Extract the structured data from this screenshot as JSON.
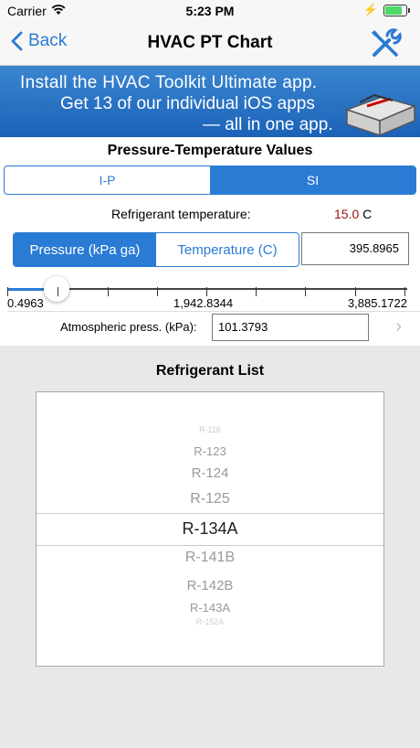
{
  "status_bar": {
    "carrier": "Carrier",
    "time": "5:23 PM"
  },
  "nav": {
    "back_label": "Back",
    "title": "HVAC PT Chart"
  },
  "banner": {
    "line1": "Install the HVAC Toolkit Ultimate app.",
    "line2": "Get 13 of our individual iOS apps",
    "line3": "— all in one app."
  },
  "section_title": "Pressure-Temperature Values",
  "units_tabs": [
    {
      "label": "I-P"
    },
    {
      "label": "SI"
    }
  ],
  "units_selected": "SI",
  "refrigerant_temperature": {
    "label": "Refrigerant temperature:",
    "value": "15.0",
    "unit": "C"
  },
  "mode_tabs": [
    {
      "label": "Pressure (kPa ga)"
    },
    {
      "label": "Temperature (C)"
    }
  ],
  "mode_selected": "Pressure (kPa ga)",
  "pressure_value": "395.8965",
  "slider": {
    "min_label": "0.4963",
    "mid_label": "1,942.8344",
    "max_label": "3,885.1722",
    "fraction": 0.1
  },
  "atmospheric": {
    "label": "Atmospheric press. (kPa):",
    "value": "101.3793"
  },
  "refrigerant_list": {
    "title": "Refrigerant List",
    "items": [
      "R-116",
      "R-123",
      "R-124",
      "R-125",
      "R-134A",
      "R-141B",
      "R-142B",
      "R-143A",
      "R-152A"
    ],
    "selected": "R-134A"
  },
  "colors": {
    "accent": "#2a7bd4",
    "temp_value": "#9b1111"
  }
}
